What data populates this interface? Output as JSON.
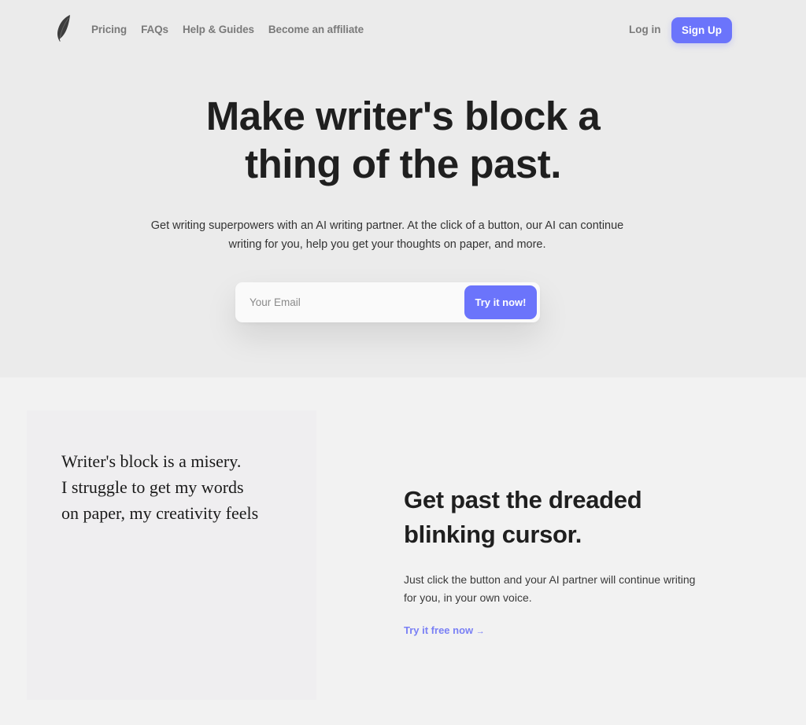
{
  "brand": {
    "logo_icon": "feather-icon",
    "accent_color": "#6b74fb",
    "link_color": "#7a80f5"
  },
  "nav": {
    "links": [
      {
        "label": "Pricing"
      },
      {
        "label": "FAQs"
      },
      {
        "label": "Help & Guides"
      },
      {
        "label": "Become an affiliate"
      }
    ],
    "login_label": "Log in",
    "signup_label": "Sign Up"
  },
  "hero": {
    "headline_line1": "Make writer's block a",
    "headline_line2": "thing of the past.",
    "subtext_line1": "Get writing superpowers with an AI writing partner. At the click of a button, our AI can continue",
    "subtext_line2": "writing for you, help you get your thoughts on paper, and more.",
    "email_placeholder": "Your Email",
    "email_value": "",
    "cta_label": "Try it now!"
  },
  "feature": {
    "demo_lines": [
      "Writer's block is a misery.",
      "I struggle to get my words",
      "on paper, my creativity feels"
    ],
    "title_line1": "Get past the dreaded",
    "title_line2": "blinking cursor.",
    "desc_line1": "Just click the button and your AI partner will continue writing",
    "desc_line2": "for you, in your own voice.",
    "link_label": "Try it free now",
    "link_arrow": "→"
  }
}
